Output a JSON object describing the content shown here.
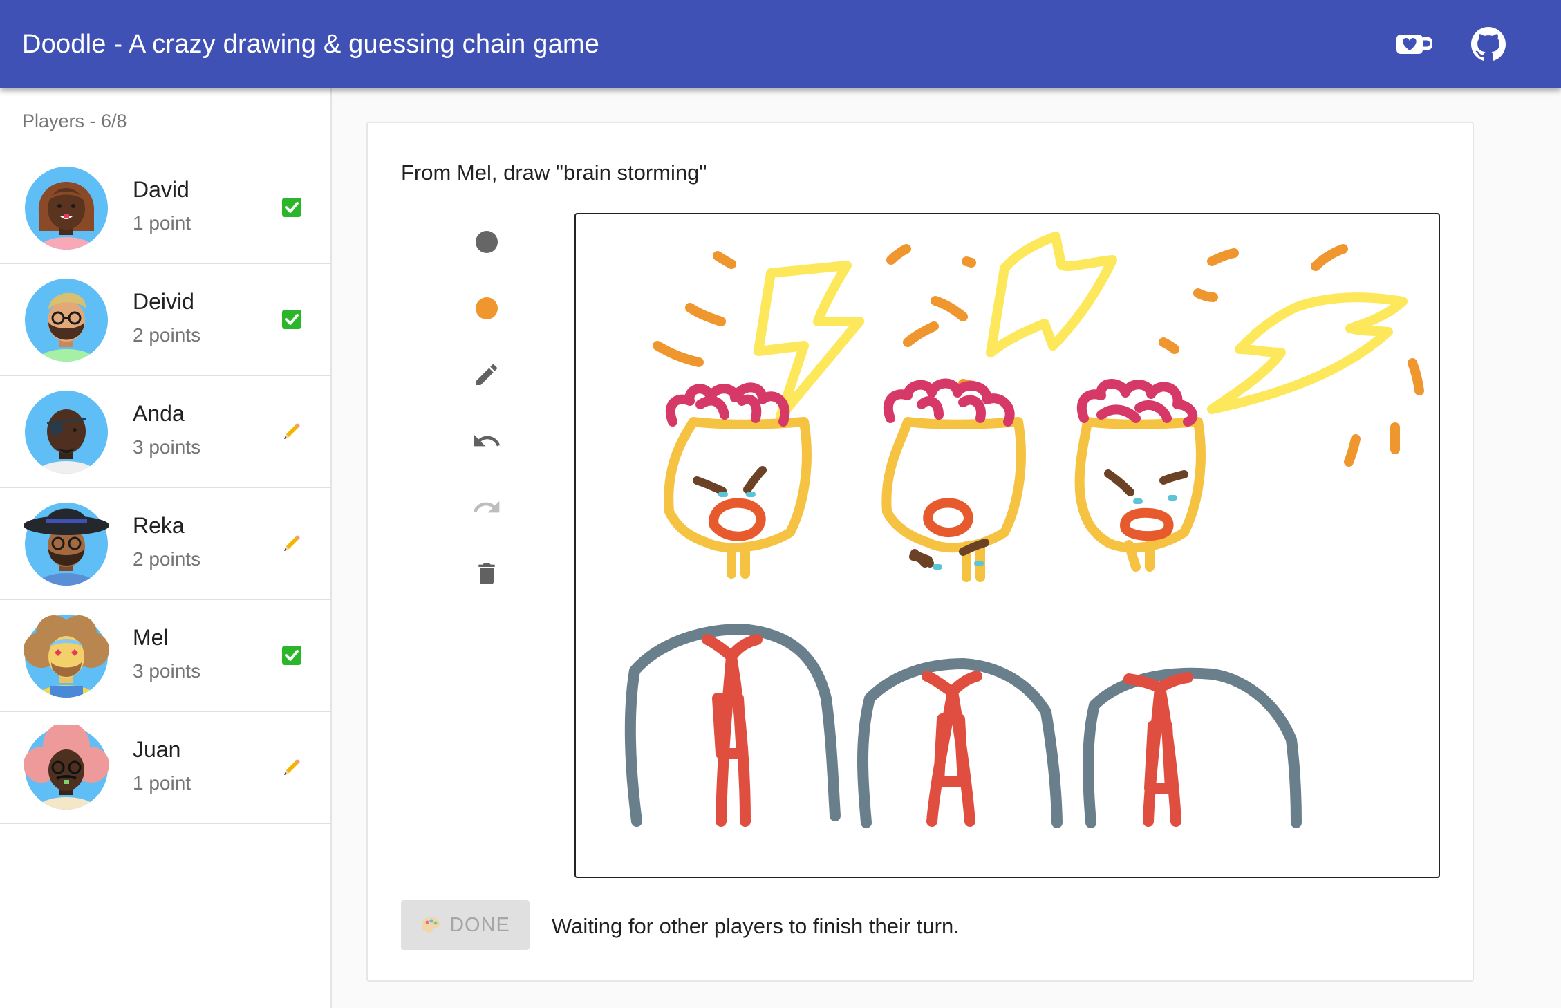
{
  "app": {
    "title": "Doodle - A crazy drawing & guessing chain game",
    "header_icons": [
      "coffee-heart-icon",
      "github-icon"
    ],
    "colors": {
      "appbar": "#3f51b5",
      "done_button_bg": "#e0e0e0"
    }
  },
  "sidebar": {
    "header": "Players - 6/8",
    "players": [
      {
        "name": "David",
        "points": "1 point",
        "status": "done-check-icon"
      },
      {
        "name": "Deivid",
        "points": "2 points",
        "status": "done-check-icon"
      },
      {
        "name": "Anda",
        "points": "3 points",
        "status": "pencil-icon"
      },
      {
        "name": "Reka",
        "points": "2 points",
        "status": "pencil-icon"
      },
      {
        "name": "Mel",
        "points": "3 points",
        "status": "done-check-icon"
      },
      {
        "name": "Juan",
        "points": "1 point",
        "status": "pencil-icon"
      }
    ]
  },
  "main": {
    "prompt": "From Mel, draw \"brain storming\"",
    "tools": [
      "brush-size-icon",
      "color-swatch-icon",
      "pencil-icon",
      "undo-icon",
      "redo-icon",
      "trash-icon"
    ],
    "tool_colors": {
      "brush": "#666666",
      "swatch": "#f0962e"
    },
    "done_label": "DONE",
    "status": "Waiting for other players to finish their turn."
  }
}
